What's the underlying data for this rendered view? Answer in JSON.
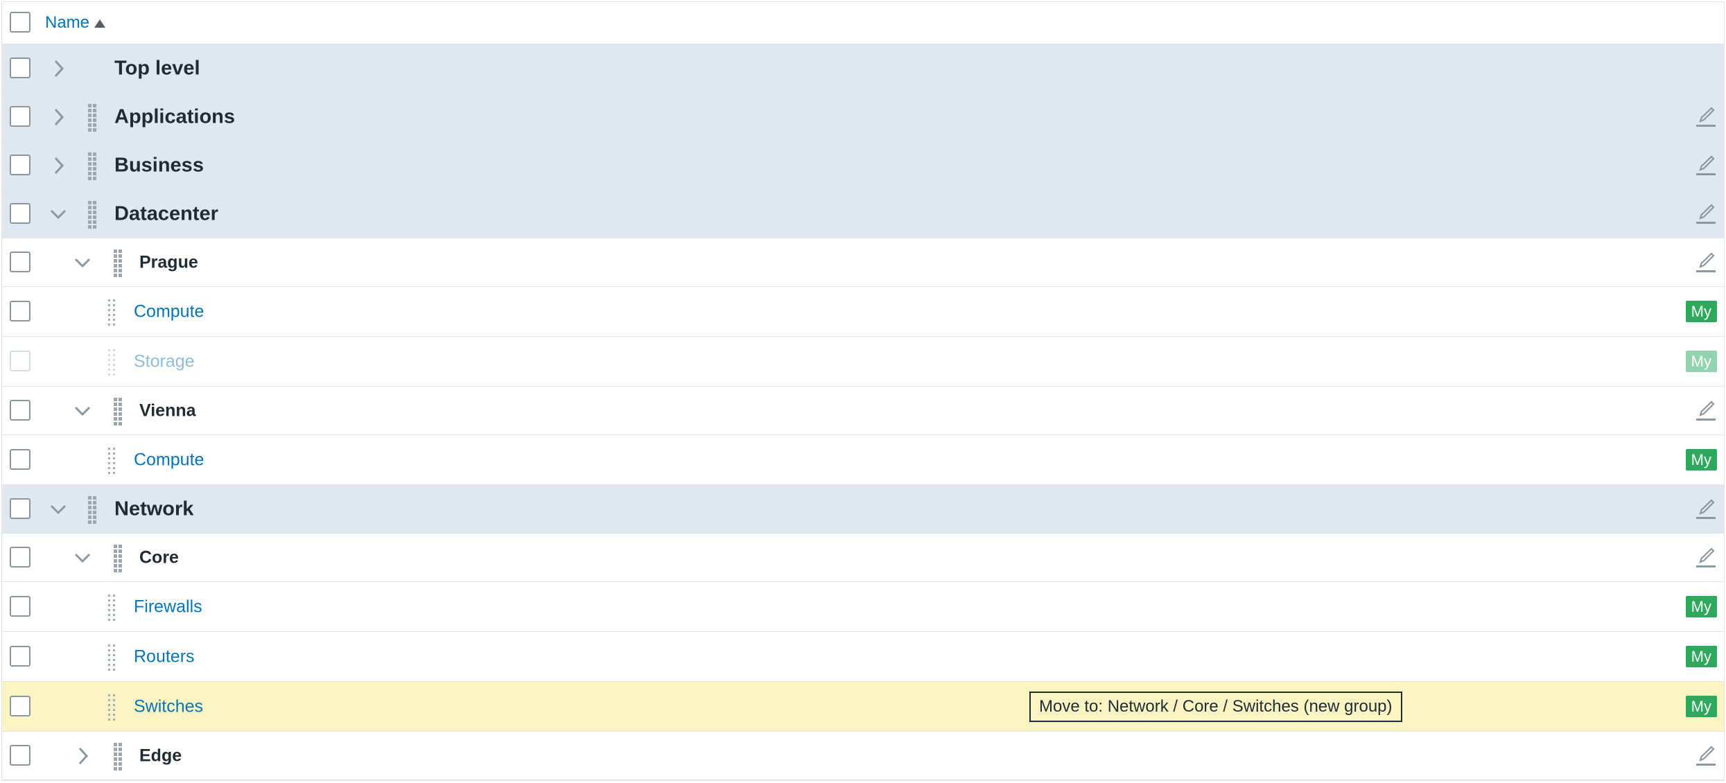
{
  "header": {
    "name_label": "Name",
    "sort_icon": "sort-ascending-icon"
  },
  "rows": [
    {
      "label": "Top level",
      "type": "group",
      "expanded": false,
      "draggable": false,
      "editable": false
    },
    {
      "label": "Applications",
      "type": "group",
      "expanded": false,
      "draggable": true,
      "editable": true
    },
    {
      "label": "Business",
      "type": "group",
      "expanded": false,
      "draggable": true,
      "editable": true
    },
    {
      "label": "Datacenter",
      "type": "group",
      "expanded": true,
      "draggable": true,
      "editable": true
    },
    {
      "label": "Prague",
      "type": "subgroup",
      "expanded": true,
      "draggable": true,
      "editable": true
    },
    {
      "label": "Compute",
      "type": "leaf",
      "badge": "My"
    },
    {
      "label": "Storage",
      "type": "leaf",
      "badge": "My",
      "disabled": true
    },
    {
      "label": "Vienna",
      "type": "subgroup",
      "expanded": true,
      "draggable": true,
      "editable": true
    },
    {
      "label": "Compute",
      "type": "leaf",
      "badge": "My"
    },
    {
      "label": "Network",
      "type": "group",
      "expanded": true,
      "draggable": true,
      "editable": true
    },
    {
      "label": "Core",
      "type": "subgroup",
      "expanded": true,
      "draggable": true,
      "editable": true
    },
    {
      "label": "Firewalls",
      "type": "leaf",
      "badge": "My"
    },
    {
      "label": "Routers",
      "type": "leaf",
      "badge": "My"
    },
    {
      "label": "Switches",
      "type": "leaf",
      "badge": "My",
      "highlighted": true,
      "tooltip": "Move to: Network / Core / Switches (new group)"
    },
    {
      "label": "Edge",
      "type": "subgroup",
      "expanded": false,
      "draggable": true,
      "editable": true
    }
  ],
  "colors": {
    "link": "#0275b8",
    "group_bg": "#dfe8f0",
    "highlight_bg": "#fcf4c2",
    "badge_bg": "#2ea85c"
  },
  "icons": {
    "expand": "chevron-right-icon",
    "collapse": "chevron-down-icon",
    "drag": "drag-handle-icon",
    "edit": "pencil-edit-icon"
  }
}
